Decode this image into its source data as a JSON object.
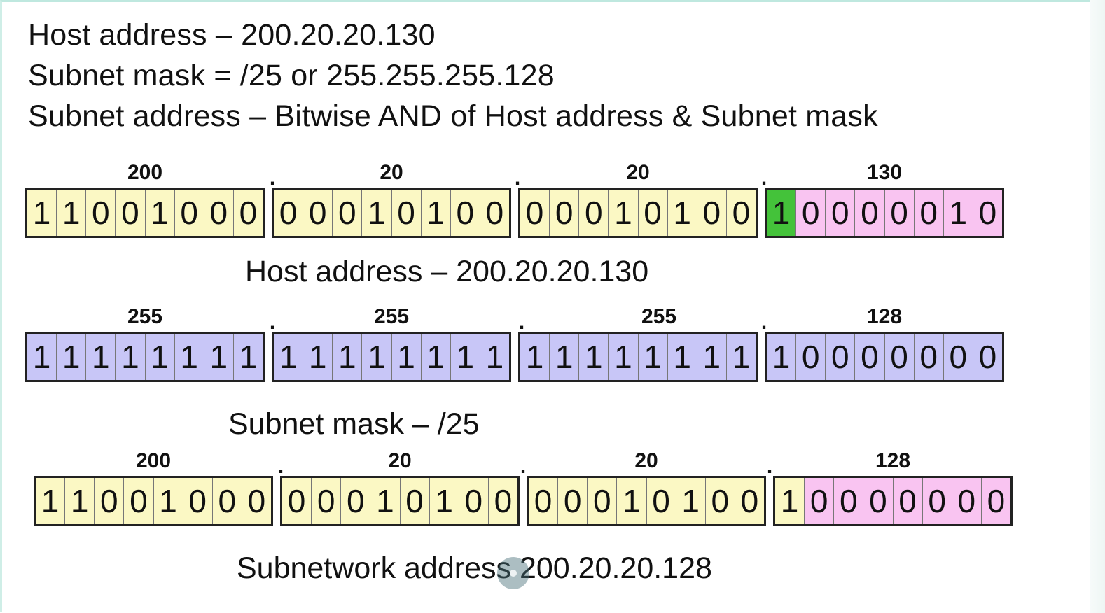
{
  "header": {
    "line1": "Host address – 200.20.20.130",
    "line2": "Subnet mask = /25 or 255.255.255.128",
    "line3": "Subnet address – Bitwise AND of Host address & Subnet mask"
  },
  "colors": {
    "yellow": "#fbf8c4",
    "pink": "#f9c4f1",
    "green": "#44c23a",
    "blue": "#c8c6f7"
  },
  "rows": [
    {
      "id": "host",
      "caption": "Host address – 200.20.20.130",
      "octets": [
        {
          "label": "200",
          "bits": [
            "1",
            "1",
            "0",
            "0",
            "1",
            "0",
            "0",
            "0"
          ],
          "colors": [
            "yellow",
            "yellow",
            "yellow",
            "yellow",
            "yellow",
            "yellow",
            "yellow",
            "yellow"
          ]
        },
        {
          "label": "20",
          "bits": [
            "0",
            "0",
            "0",
            "1",
            "0",
            "1",
            "0",
            "0"
          ],
          "colors": [
            "yellow",
            "yellow",
            "yellow",
            "yellow",
            "yellow",
            "yellow",
            "yellow",
            "yellow"
          ]
        },
        {
          "label": "20",
          "bits": [
            "0",
            "0",
            "0",
            "1",
            "0",
            "1",
            "0",
            "0"
          ],
          "colors": [
            "yellow",
            "yellow",
            "yellow",
            "yellow",
            "yellow",
            "yellow",
            "yellow",
            "yellow"
          ]
        },
        {
          "label": "130",
          "bits": [
            "1",
            "0",
            "0",
            "0",
            "0",
            "0",
            "1",
            "0"
          ],
          "colors": [
            "green",
            "pink",
            "pink",
            "pink",
            "pink",
            "pink",
            "pink",
            "pink"
          ]
        }
      ]
    },
    {
      "id": "mask",
      "caption": "Subnet mask – /25",
      "octets": [
        {
          "label": "255",
          "bits": [
            "1",
            "1",
            "1",
            "1",
            "1",
            "1",
            "1",
            "1"
          ],
          "colors": [
            "blue",
            "blue",
            "blue",
            "blue",
            "blue",
            "blue",
            "blue",
            "blue"
          ]
        },
        {
          "label": "255",
          "bits": [
            "1",
            "1",
            "1",
            "1",
            "1",
            "1",
            "1",
            "1"
          ],
          "colors": [
            "blue",
            "blue",
            "blue",
            "blue",
            "blue",
            "blue",
            "blue",
            "blue"
          ]
        },
        {
          "label": "255",
          "bits": [
            "1",
            "1",
            "1",
            "1",
            "1",
            "1",
            "1",
            "1"
          ],
          "colors": [
            "blue",
            "blue",
            "blue",
            "blue",
            "blue",
            "blue",
            "blue",
            "blue"
          ]
        },
        {
          "label": "128",
          "bits": [
            "1",
            "0",
            "0",
            "0",
            "0",
            "0",
            "0",
            "0"
          ],
          "colors": [
            "blue",
            "blue",
            "blue",
            "blue",
            "blue",
            "blue",
            "blue",
            "blue"
          ]
        }
      ]
    },
    {
      "id": "subnet",
      "caption": "Subnetwork address 200.20.20.128",
      "octets": [
        {
          "label": "200",
          "bits": [
            "1",
            "1",
            "0",
            "0",
            "1",
            "0",
            "0",
            "0"
          ],
          "colors": [
            "yellow",
            "yellow",
            "yellow",
            "yellow",
            "yellow",
            "yellow",
            "yellow",
            "yellow"
          ]
        },
        {
          "label": "20",
          "bits": [
            "0",
            "0",
            "0",
            "1",
            "0",
            "1",
            "0",
            "0"
          ],
          "colors": [
            "yellow",
            "yellow",
            "yellow",
            "yellow",
            "yellow",
            "yellow",
            "yellow",
            "yellow"
          ]
        },
        {
          "label": "20",
          "bits": [
            "0",
            "0",
            "0",
            "1",
            "0",
            "1",
            "0",
            "0"
          ],
          "colors": [
            "yellow",
            "yellow",
            "yellow",
            "yellow",
            "yellow",
            "yellow",
            "yellow",
            "yellow"
          ]
        },
        {
          "label": "128",
          "bits": [
            "1",
            "0",
            "0",
            "0",
            "0",
            "0",
            "0",
            "0"
          ],
          "colors": [
            "yellow",
            "pink",
            "pink",
            "pink",
            "pink",
            "pink",
            "pink",
            "pink"
          ]
        }
      ]
    }
  ],
  "separator": "."
}
